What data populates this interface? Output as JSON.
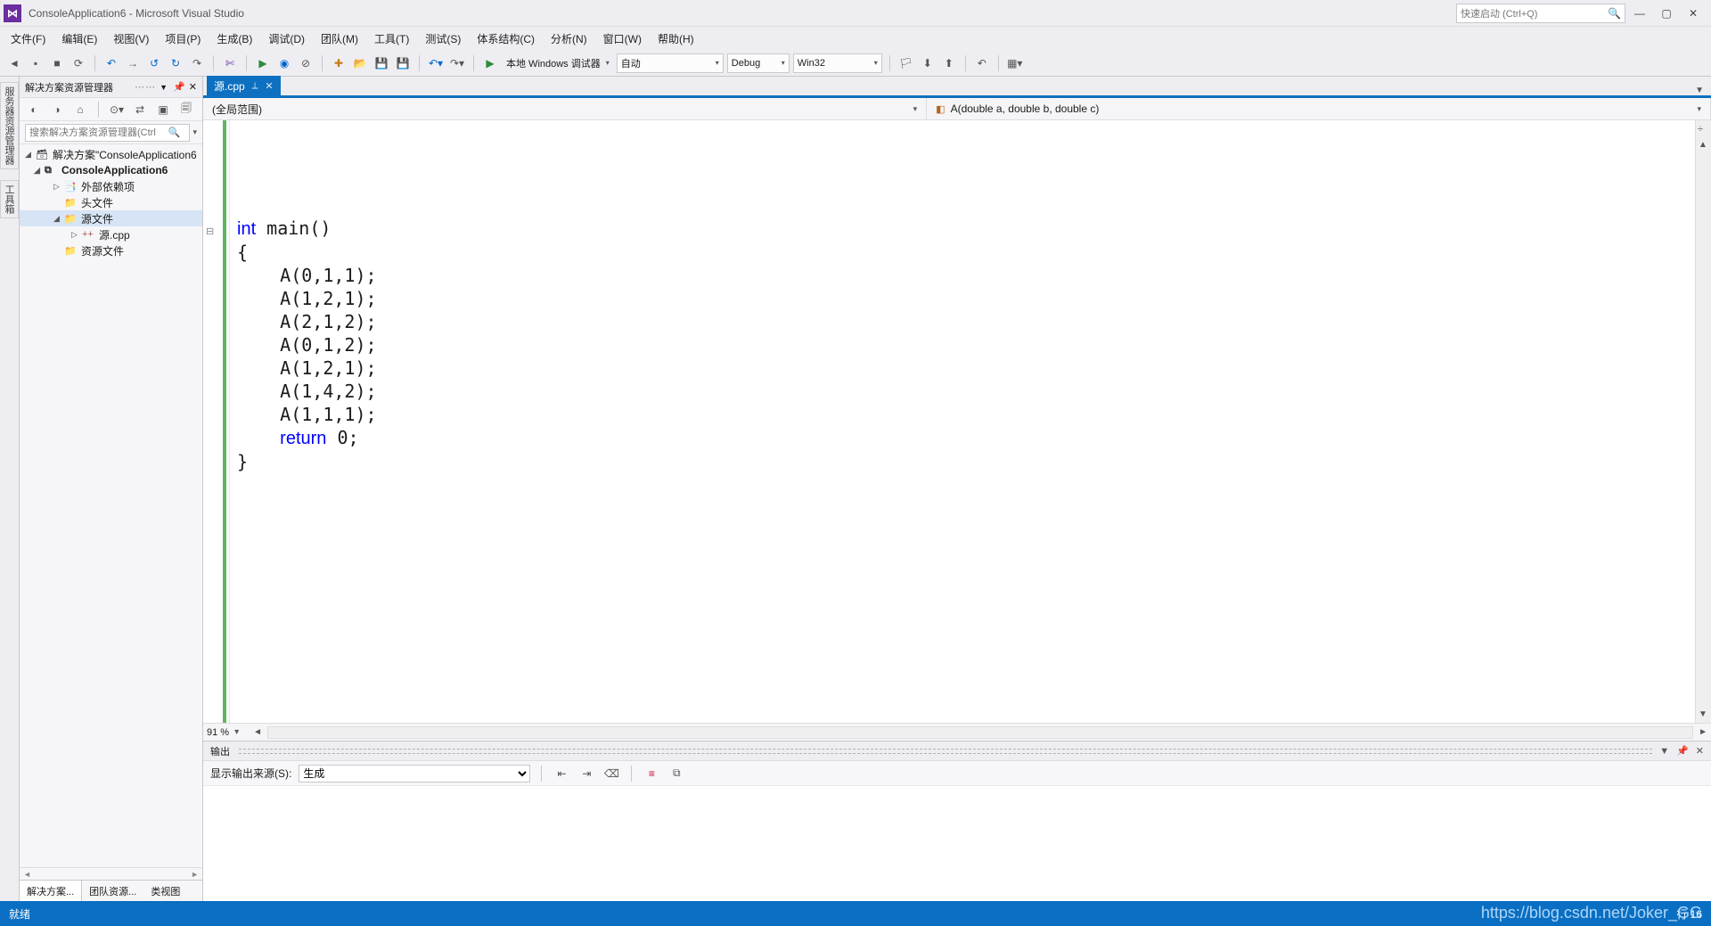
{
  "title": "ConsoleApplication6 - Microsoft Visual Studio",
  "quicklaunch_placeholder": "快速启动 (Ctrl+Q)",
  "menu": {
    "file": "文件(F)",
    "edit": "编辑(E)",
    "view": "视图(V)",
    "project": "项目(P)",
    "build": "生成(B)",
    "debug": "调试(D)",
    "team": "团队(M)",
    "tools": "工具(T)",
    "test": "测试(S)",
    "arch": "体系结构(C)",
    "analyze": "分析(N)",
    "window": "窗口(W)",
    "help": "帮助(H)"
  },
  "toolbar": {
    "debugger": "本地 Windows 调试器",
    "mode": "自动",
    "config": "Debug",
    "platform": "Win32"
  },
  "sln": {
    "title": "解决方案资源管理器",
    "search_placeholder": "搜索解决方案资源管理器(Ctrl",
    "root": "解决方案\"ConsoleApplication6",
    "project": "ConsoleApplication6",
    "ext": "外部依赖项",
    "headers": "头文件",
    "sources": "源文件",
    "srcfile": "源.cpp",
    "resources": "资源文件",
    "bt_active": "解决方案...",
    "bt2": "团队资源...",
    "bt3": "类视图"
  },
  "rails": {
    "server": "服务器资源管理器",
    "toolbox": "工具箱"
  },
  "tab": {
    "name": "源.cpp"
  },
  "nav": {
    "scope": "(全局范围)",
    "func": "A(double a, double b, double c)"
  },
  "code": {
    "l1": "int main()",
    "l2": "{",
    "l3": "    A(0,1,1);",
    "l4": "    A(1,2,1);",
    "l5": "    A(2,1,2);",
    "l6": "    A(0,1,2);",
    "l7": "    A(1,2,1);",
    "l8": "    A(1,4,2);",
    "l9": "    A(1,1,1);",
    "l10": "    return 0;",
    "l11": "}"
  },
  "zoom": "91 %",
  "output": {
    "title": "输出",
    "from_label": "显示输出来源(S):",
    "from_value": "生成"
  },
  "status": {
    "ready": "就绪",
    "line": "行 16",
    "col_watermark": "https://blog.csdn.net/Joker_GG"
  }
}
